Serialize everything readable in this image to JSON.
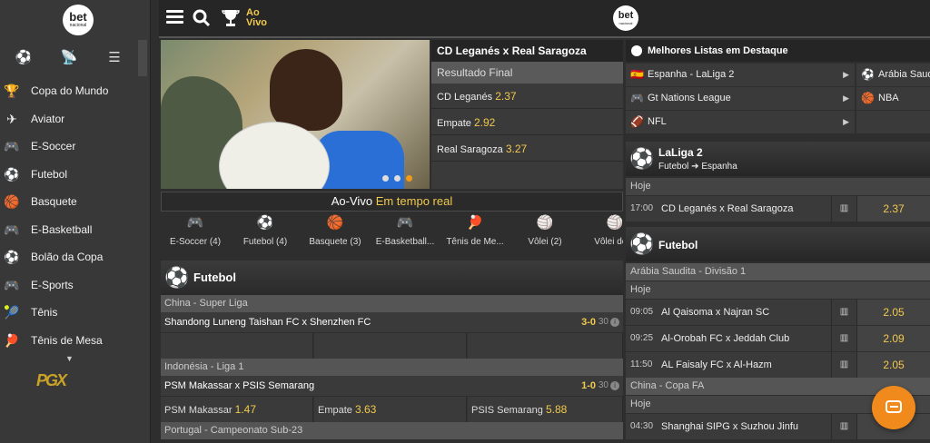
{
  "brand": {
    "logo_text": "bet",
    "logo_sub": "nacional"
  },
  "sidebar": {
    "tabs": [
      {
        "icon": "soccer-ball-icon",
        "glyph": "⚽"
      },
      {
        "icon": "live-signal-icon",
        "glyph": "📡"
      },
      {
        "icon": "list-icon",
        "glyph": "☰"
      }
    ],
    "items": [
      {
        "label": "Copa do Mundo",
        "icon": "trophy-icon",
        "glyph": "🏆"
      },
      {
        "label": "Aviator",
        "icon": "plane-icon",
        "glyph": "✈"
      },
      {
        "label": "E-Soccer",
        "icon": "gamepad-icon",
        "glyph": "🎮"
      },
      {
        "label": "Futebol",
        "icon": "soccer-ball-icon",
        "glyph": "⚽"
      },
      {
        "label": "Basquete",
        "icon": "basketball-icon",
        "glyph": "🏀"
      },
      {
        "label": "E-Basketball",
        "icon": "gamepad-icon",
        "glyph": "🎮"
      },
      {
        "label": "Bolão da Copa",
        "icon": "cup-ball-icon",
        "glyph": "⚽"
      },
      {
        "label": "E-Sports",
        "icon": "gamepad-icon",
        "glyph": "🎮"
      },
      {
        "label": "Tênis",
        "icon": "tennis-ball-icon",
        "glyph": "🎾"
      },
      {
        "label": "Tênis de Mesa",
        "icon": "ping-pong-icon",
        "glyph": "🏓"
      }
    ],
    "more_glyph": "▼",
    "promo_text": "PGX"
  },
  "topbar": {
    "live_label_1": "Ao",
    "live_label_2": "Vivo"
  },
  "hero": {
    "match_title": "CD Leganés x Real Saragoza",
    "market": "Resultado Final",
    "odds": [
      {
        "label": "CD Leganés",
        "value": "2.37"
      },
      {
        "label": "Empate",
        "value": "2.92"
      },
      {
        "label": "Real Saragoza",
        "value": "3.27"
      }
    ],
    "slides": 3,
    "active_slide": 3
  },
  "live_strip": {
    "label": "Ao-Vivo",
    "highlight": "Em tempo real"
  },
  "sport_tabs": [
    {
      "label": "E-Soccer (4)",
      "icon": "gamepad-icon",
      "glyph": "🎮"
    },
    {
      "label": "Futebol (4)",
      "icon": "soccer-ball-icon",
      "glyph": "⚽"
    },
    {
      "label": "Basquete (3)",
      "icon": "basketball-icon",
      "glyph": "🏀"
    },
    {
      "label": "E-Basketball...",
      "icon": "gamepad-icon",
      "glyph": "🎮"
    },
    {
      "label": "Tênis de Me...",
      "icon": "ping-pong-icon",
      "glyph": "🏓"
    },
    {
      "label": "Vôlei (2)",
      "icon": "volleyball-icon",
      "glyph": "🏐"
    },
    {
      "label": "Vôlei de P",
      "icon": "volleyball-icon",
      "glyph": "🏐"
    }
  ],
  "live_section": {
    "title": "Futebol",
    "groups": [
      {
        "league": "China - Super Liga",
        "match": "Shandong Luneng Taishan FC x Shenzhen FC",
        "score": "3-0",
        "minute": "30",
        "odds": [
          "",
          "",
          ""
        ]
      },
      {
        "league": "Indonésia - Liga 1",
        "match": "PSM Makassar x PSIS Semarang",
        "score": "1-0",
        "minute": "30",
        "odds": [
          {
            "label": "PSM Makassar",
            "value": "1.47"
          },
          {
            "label": "Empate",
            "value": "3.63"
          },
          {
            "label": "PSIS Semarang",
            "value": "5.88"
          }
        ]
      },
      {
        "league": "Portugal - Campeonato Sub-23"
      }
    ]
  },
  "right": {
    "featured_title": "Melhores Listas em Destaque",
    "featured": [
      {
        "label": "Espanha - LaLiga 2",
        "icon": "spain-flag-icon",
        "glyph": "🇪🇸"
      },
      {
        "label": "Arábia Saudita",
        "icon": "soccer-ball-icon",
        "glyph": "⚽"
      },
      {
        "label": "Gt Nations League",
        "icon": "gamepad-icon",
        "glyph": "🎮"
      },
      {
        "label": "NBA",
        "icon": "basketball-icon",
        "glyph": "🏀"
      },
      {
        "label": "NFL",
        "icon": "american-football-icon",
        "glyph": "🏈"
      }
    ],
    "laliga": {
      "title": "LaLiga 2",
      "breadcrumb_1": "Futebol",
      "breadcrumb_arrow": "➔",
      "breadcrumb_2": "Espanha",
      "day": "Hoje",
      "matches": [
        {
          "time": "17:00",
          "name": "CD Leganés x Real Saragoza",
          "odd": "2.37"
        }
      ]
    },
    "futebol": {
      "title": "Futebol",
      "leagues": [
        {
          "name": "Arábia Saudita - Divisão 1",
          "day": "Hoje",
          "matches": [
            {
              "time": "09:05",
              "name": "Al Qaisoma x Najran SC",
              "odd": "2.05"
            },
            {
              "time": "09:25",
              "name": "Al-Orobah FC x Jeddah Club",
              "odd": "2.09"
            },
            {
              "time": "11:50",
              "name": "AL Faisaly FC x Al-Hazm",
              "odd": "2.05"
            }
          ]
        },
        {
          "name": "China - Copa FA",
          "day": "Hoje",
          "matches": [
            {
              "time": "04:30",
              "name": "Shanghai SIPG x Suzhou Jinfu",
              "odd": ""
            }
          ]
        }
      ]
    }
  }
}
